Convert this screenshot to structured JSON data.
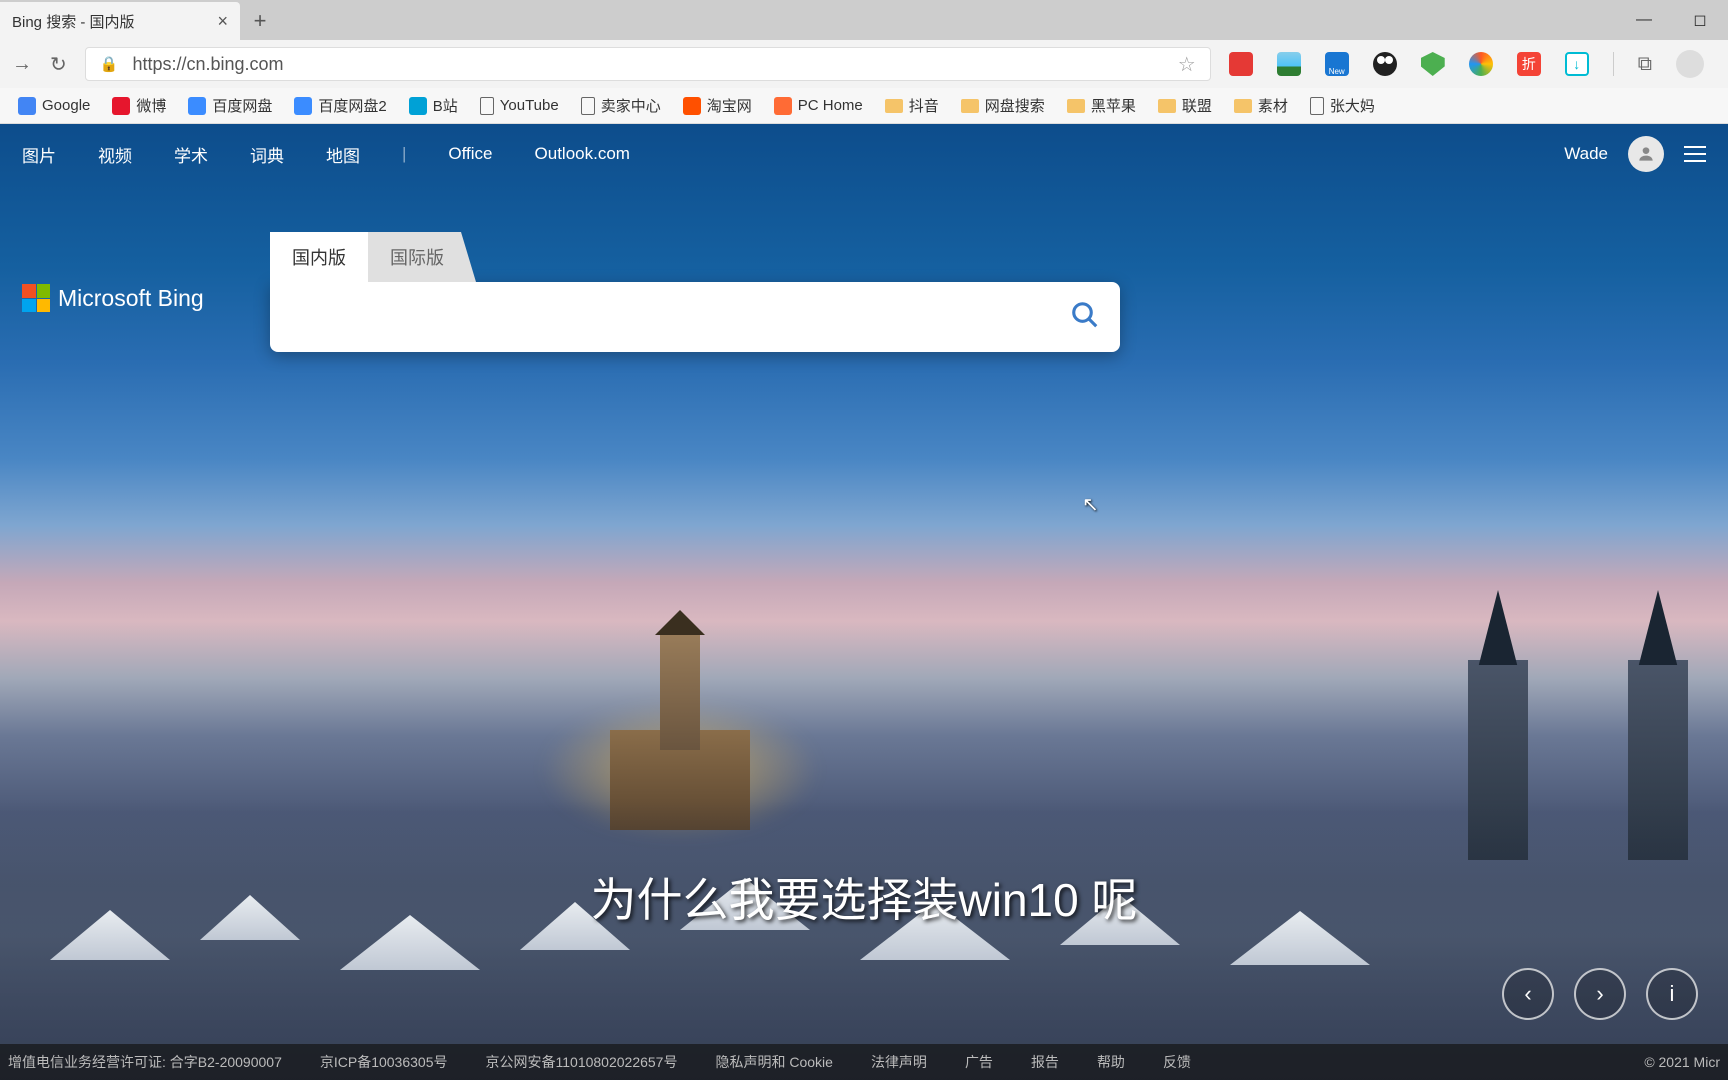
{
  "browser": {
    "tab_title": "Bing 搜索 - 国内版",
    "url": "https://cn.bing.com",
    "bookmarks": [
      {
        "label": "Google",
        "icon_color": "#4285f4",
        "type": "favicon"
      },
      {
        "label": "微博",
        "icon_color": "#e6162d",
        "type": "favicon"
      },
      {
        "label": "百度网盘",
        "icon_color": "#3b8cff",
        "type": "favicon"
      },
      {
        "label": "百度网盘2",
        "icon_color": "#3b8cff",
        "type": "favicon"
      },
      {
        "label": "B站",
        "icon_color": "#00a1d6",
        "type": "favicon"
      },
      {
        "label": "YouTube",
        "type": "page"
      },
      {
        "label": "卖家中心",
        "type": "page"
      },
      {
        "label": "淘宝网",
        "icon_color": "#ff5000",
        "type": "favicon"
      },
      {
        "label": "PC Home",
        "icon_color": "#ff6b35",
        "type": "favicon"
      },
      {
        "label": "抖音",
        "type": "folder"
      },
      {
        "label": "网盘搜索",
        "type": "folder"
      },
      {
        "label": "黑苹果",
        "type": "folder"
      },
      {
        "label": "联盟",
        "type": "folder"
      },
      {
        "label": "素材",
        "type": "folder"
      },
      {
        "label": "张大妈",
        "type": "page"
      }
    ],
    "extensions": [
      {
        "name": "ext-red",
        "color": "#e53935"
      },
      {
        "name": "ext-landscape",
        "color": "#4fc3f7"
      },
      {
        "name": "ext-new",
        "color": "#1976d2",
        "badge": "New"
      },
      {
        "name": "ext-dark",
        "color": "#212121"
      },
      {
        "name": "ext-shield",
        "color": "#4caf50"
      },
      {
        "name": "ext-circle",
        "color": "linear-gradient(45deg,#ff5722,#ffc107,#4caf50,#2196f3)"
      },
      {
        "name": "ext-zhe",
        "color": "#f44336",
        "text": "折"
      },
      {
        "name": "ext-sync",
        "color": "#00bcd4"
      }
    ]
  },
  "bing": {
    "nav": [
      "图片",
      "视频",
      "学术",
      "词典",
      "地图"
    ],
    "nav_right": [
      "Office",
      "Outlook.com"
    ],
    "user": "Wade",
    "logo_text": "Microsoft Bing",
    "tabs": {
      "active": "国内版",
      "inactive": "国际版"
    },
    "search_placeholder": "",
    "footer_left": [
      "增值电信业务经营许可证: 合字B2-20090007",
      "京ICP备10036305号",
      "京公网安备11010802022657号",
      "隐私声明和 Cookie",
      "法律声明",
      "广告",
      "报告",
      "帮助",
      "反馈"
    ],
    "footer_right": "© 2021 Micr"
  },
  "subtitle": "为什么我要选择装win10 呢"
}
